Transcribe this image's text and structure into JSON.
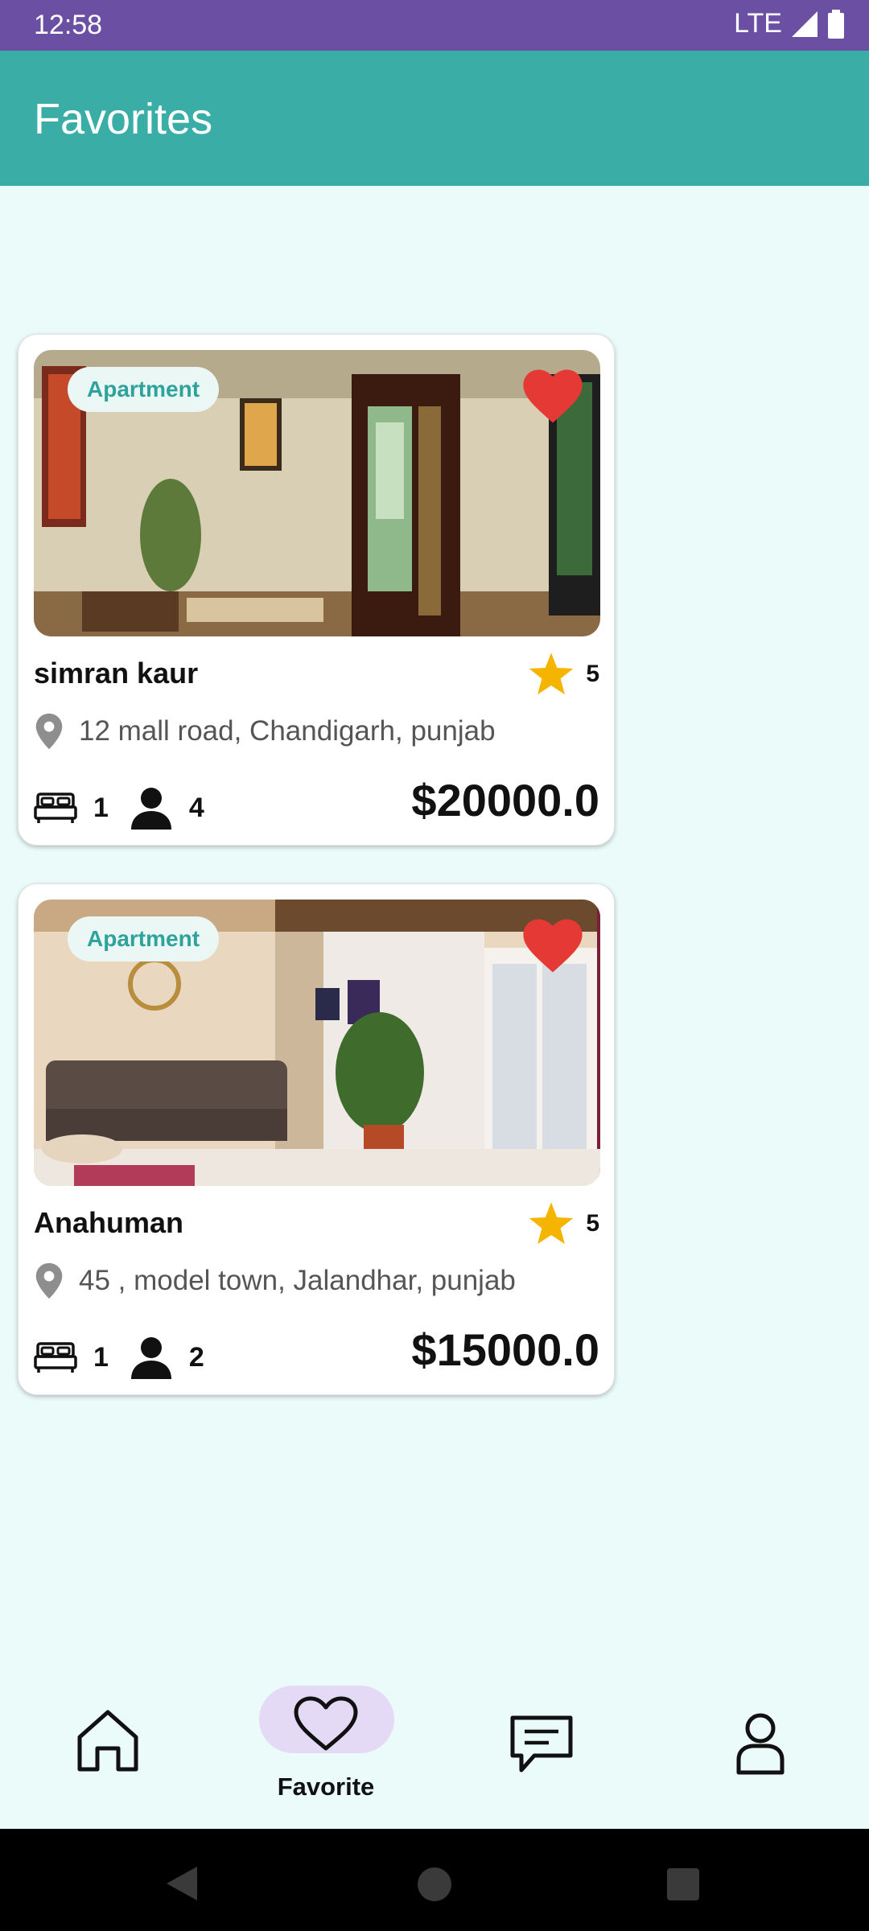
{
  "status_bar": {
    "time": "12:58",
    "network": "LTE"
  },
  "app_bar": {
    "title": "Favorites"
  },
  "listings": [
    {
      "type": "Apartment",
      "owner": "simran kaur",
      "rating": "5",
      "address": "12 mall road, Chandigarh, punjab",
      "beds": "1",
      "guests": "4",
      "price": "$20000.0",
      "favorited": true
    },
    {
      "type": "Apartment",
      "owner": "Anahuman",
      "rating": "5",
      "address": "45 , model town, Jalandhar, punjab",
      "beds": "1",
      "guests": "2",
      "price": "$15000.0",
      "favorited": true
    }
  ],
  "bottom_nav": {
    "items": [
      {
        "icon": "home-icon",
        "label": ""
      },
      {
        "icon": "heart-icon",
        "label": "Favorite",
        "active": true
      },
      {
        "icon": "message-icon",
        "label": ""
      },
      {
        "icon": "profile-icon",
        "label": ""
      }
    ]
  },
  "colors": {
    "status_bar": "#6a4fa3",
    "app_bar": "#3aaea6",
    "background": "#ebfbf9",
    "favorite_heart": "#e53935",
    "rating_star": "#f5b400",
    "chip_text": "#2ea39b",
    "nav_active_pill": "#e5daf5"
  }
}
